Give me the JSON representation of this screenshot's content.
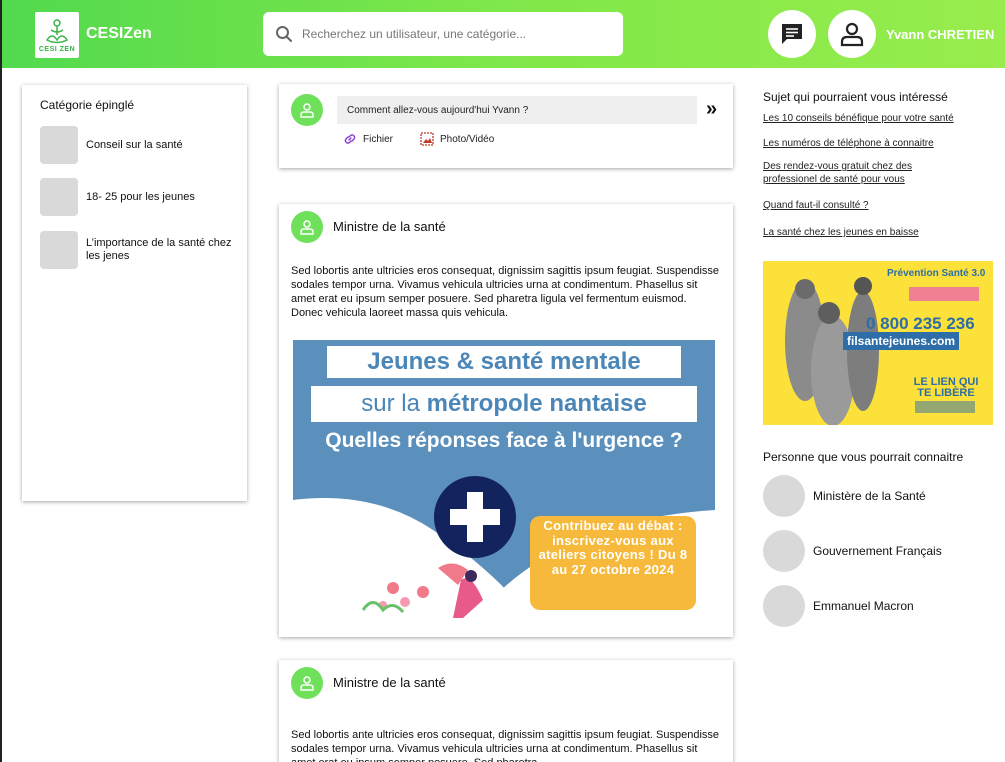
{
  "header": {
    "logo_text": "CESI ZEN",
    "brand": "CESIZen",
    "search_placeholder": "Recherchez un utilisateur, une catégorie...",
    "username": "Yvann CHRETIEN"
  },
  "left_panel": {
    "title": "Catégorie épinglé",
    "categories": [
      {
        "label": "Conseil sur la santé"
      },
      {
        "label": "18- 25 pour les jeunes"
      },
      {
        "label": "L’importance de la santé chez les jenes"
      }
    ]
  },
  "composer": {
    "placeholder": "Comment allez-vous aujourd'hui Yvann ?",
    "file_label": "Fichier",
    "media_label": "Photo/Vidéo"
  },
  "posts": [
    {
      "author": "Ministre de la santé",
      "text": "Sed lobortis ante ultricies eros consequat, dignissim sagittis ipsum feugiat. Suspendisse sodales tempor urna. Vivamus vehicula ultricies urna at condimentum. Phasellus sit amet erat eu ipsum semper posuere. Sed pharetra ligula vel fermentum euismod. Donec vehicula laoreet massa quis vehicula.",
      "image": {
        "line1": "Jeunes & santé mentale",
        "line2_a": "sur la ",
        "line2_b": "métropole nantaise",
        "line3": "Quelles réponses face à l'urgence ?",
        "badge": "Contribuez au débat : inscrivez-vous aux ateliers citoyens ! Du 8 au 27 octobre 2024"
      }
    },
    {
      "author": "Ministre de la santé",
      "text": "Sed lobortis ante ultricies eros consequat, dignissim sagittis ipsum feugiat. Suspendisse sodales tempor urna. Vivamus vehicula ultricies urna at condimentum. Phasellus sit amet erat eu ipsum semper posuere. Sed pharetra"
    }
  ],
  "right_panel": {
    "topics_title": "Sujet qui pourraient vous intéressé",
    "topics": [
      "Les 10 conseils bénéfique pour votre santé",
      "Les numéros de téléphone à connaitre",
      "Des rendez-vous gratuit chez des professionel de santé pour vous",
      "Quand faut-il consulté ?",
      "La santé chez les jeunes en baisse"
    ],
    "ad": {
      "title": "Prévention Santé 3.0",
      "phone": "0 800 235 236",
      "site": "filsantejeunes.com",
      "tagline": "LE LIEN QUI TE LIBÈRE"
    },
    "persons_title": "Personne que vous pourrait connaitre",
    "persons": [
      "Ministère de la Santé",
      "Gouvernement Français",
      "Emmanuel Macron"
    ]
  },
  "colors": {
    "header_start": "#52d94e",
    "header_end": "#98ec4c",
    "avatar_green": "#6ee05a",
    "image_blue": "#5b8fbc",
    "badge_orange": "#f6b93b",
    "ad_yellow": "#fbe13a"
  },
  "icons": [
    "search-icon",
    "chat-icon",
    "user-icon",
    "link-icon",
    "image-icon",
    "double-chevron-icon",
    "cross-icon"
  ]
}
